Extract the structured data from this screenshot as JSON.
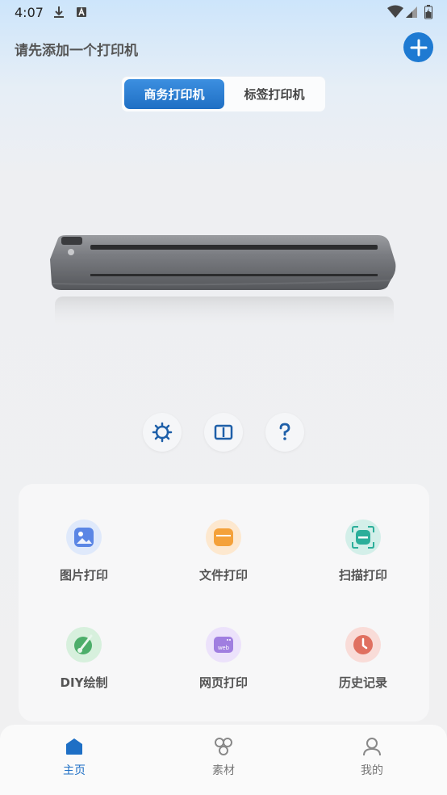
{
  "status_bar": {
    "time": "4:07"
  },
  "header": {
    "title": "请先添加一个打印机"
  },
  "printer_type_tabs": [
    {
      "label": "商务打印机",
      "active": true
    },
    {
      "label": "标签打印机",
      "active": false
    }
  ],
  "tools": [
    {
      "icon": "settings-gear-icon"
    },
    {
      "icon": "book-manual-icon"
    },
    {
      "icon": "help-question-icon"
    }
  ],
  "features": [
    {
      "label": "图片打印",
      "icon": "image-icon",
      "color": "#5b86e5"
    },
    {
      "label": "文件打印",
      "icon": "folder-icon",
      "color": "#f4a13a"
    },
    {
      "label": "扫描打印",
      "icon": "scan-icon",
      "color": "#2cae9a"
    },
    {
      "label": "DIY绘制",
      "icon": "paint-brush-icon",
      "color": "#4cae6a"
    },
    {
      "label": "网页打印",
      "icon": "web-icon",
      "color": "#a07ee0"
    },
    {
      "label": "历史记录",
      "icon": "history-clock-icon",
      "color": "#e07060"
    }
  ],
  "bottom_nav": [
    {
      "label": "主页",
      "icon": "home-icon",
      "active": true
    },
    {
      "label": "素材",
      "icon": "material-icon",
      "active": false
    },
    {
      "label": "我的",
      "icon": "profile-icon",
      "active": false
    }
  ],
  "colors": {
    "accent": "#1e7ad2",
    "active_nav": "#1e6fc5"
  }
}
